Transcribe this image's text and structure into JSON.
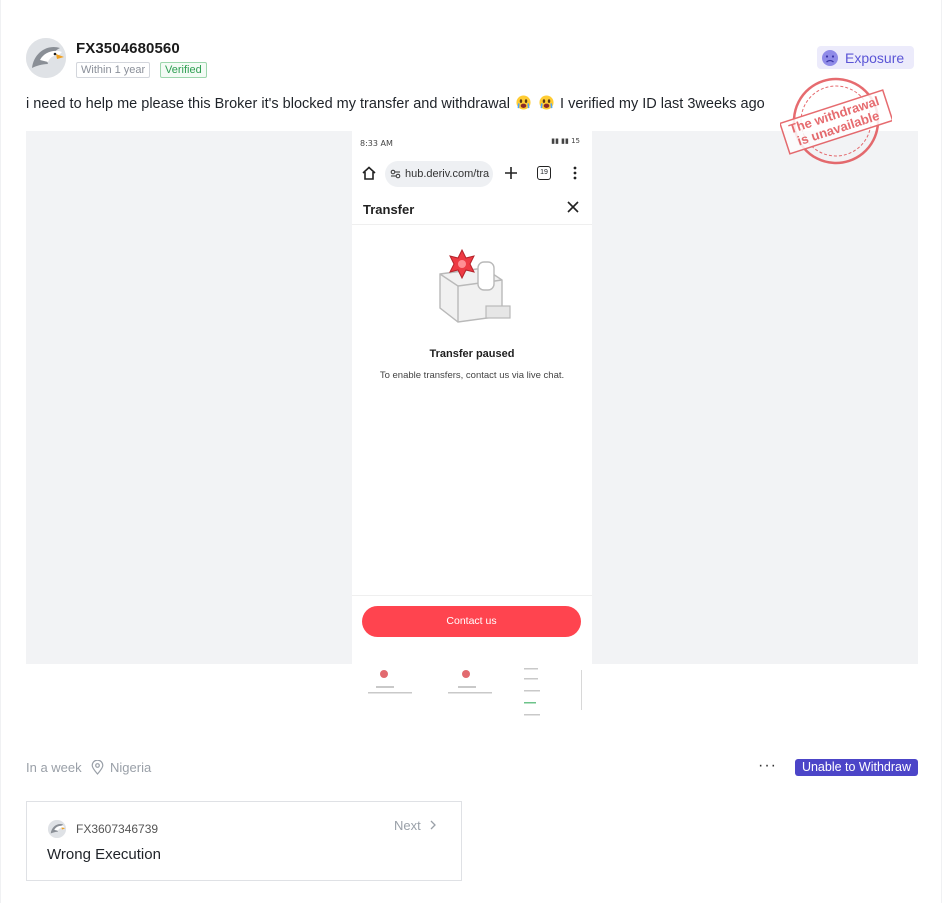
{
  "post": {
    "username": "FX3504680560",
    "tag_time": "Within 1 year",
    "tag_verified": "Verified",
    "exposure_label": "Exposure",
    "text_part1": "i need to help me please this Broker it's blocked my transfer and withdrawal",
    "text_part2": "I verified my ID last 3weeks ago",
    "stamp_line1": "The withdrawal",
    "stamp_line2": "is unavailable"
  },
  "screenshot": {
    "status_time": "8:33 AM",
    "status_icons": "▮▮ ▮▮ 15",
    "url": "hub.deriv.com/tra",
    "tab_count": "19",
    "sheet_title": "Transfer",
    "paused_title": "Transfer paused",
    "paused_desc": "To enable transfers, contact us via live chat.",
    "contact_button": "Contact us"
  },
  "meta": {
    "time": "In a week",
    "location": "Nigeria",
    "more": "···",
    "category_badge": "Unable to Withdraw"
  },
  "next": {
    "username": "FX3607346739",
    "label": "Next",
    "title": "Wrong Execution"
  },
  "colors": {
    "exposure_bg": "#ecebfb",
    "exposure_text": "#5b55d6",
    "badge_bg": "#4c45c8",
    "contact_btn": "#ff444f",
    "verified": "#2e9e52",
    "stamp": "#e0474c"
  }
}
